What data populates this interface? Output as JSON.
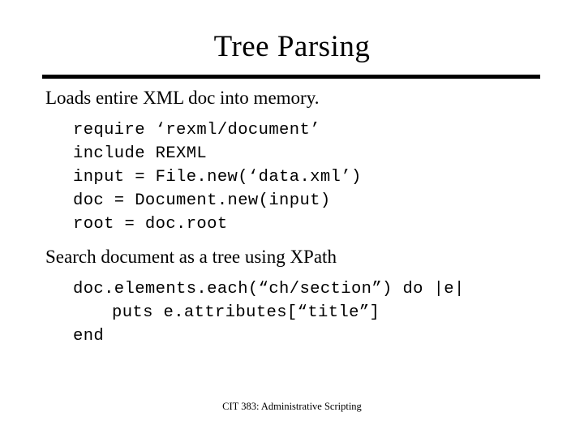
{
  "slide": {
    "title": "Tree Parsing",
    "footer": "CIT 383: Administrative Scripting",
    "bullets": [
      {
        "text": "Loads entire XML doc into memory."
      },
      {
        "text": "Search document as a tree using XPath"
      }
    ],
    "code_block_1": [
      "require ‘rexml/document’",
      "include REXML",
      "input = File.new(‘data.xml’)",
      "doc = Document.new(input)",
      "root = doc.root"
    ],
    "code_block_2": [
      "doc.elements.each(“ch/section”) do |e|",
      "puts e.attributes[“title”]",
      "end"
    ]
  }
}
